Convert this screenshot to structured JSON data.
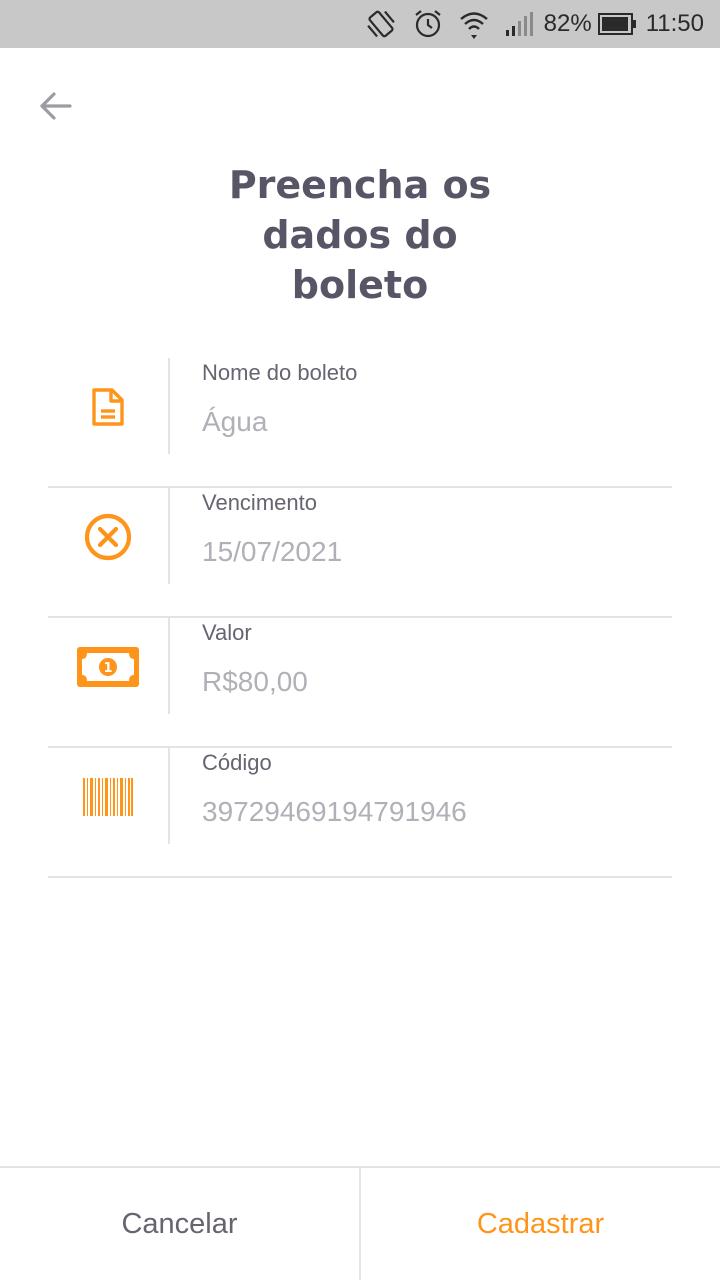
{
  "status_bar": {
    "battery_percent": "82%",
    "time": "11:50",
    "icons": [
      "vibrate-icon",
      "alarm-icon",
      "wifi-icon",
      "signal-icon",
      "battery-icon"
    ]
  },
  "header": {
    "back_icon": "arrow-left-icon",
    "title": "Preencha os dados do boleto"
  },
  "form": {
    "fields": [
      {
        "icon": "document-icon",
        "label": "Nome do boleto",
        "placeholder": "Água"
      },
      {
        "icon": "close-circle-icon",
        "label": "Vencimento",
        "placeholder": "15/07/2021"
      },
      {
        "icon": "money-icon",
        "label": "Valor",
        "placeholder": "R$80,00"
      },
      {
        "icon": "barcode-icon",
        "label": "Código",
        "placeholder": "39729469194791946"
      }
    ]
  },
  "actions": {
    "cancel_label": "Cancelar",
    "submit_label": "Cadastrar"
  },
  "colors": {
    "accent": "#ff941a",
    "title": "#585666",
    "body_text": "#666470",
    "placeholder": "#b1b0b8",
    "divider": "#e3e3e6",
    "status_bar_bg": "#c8c8c8"
  }
}
